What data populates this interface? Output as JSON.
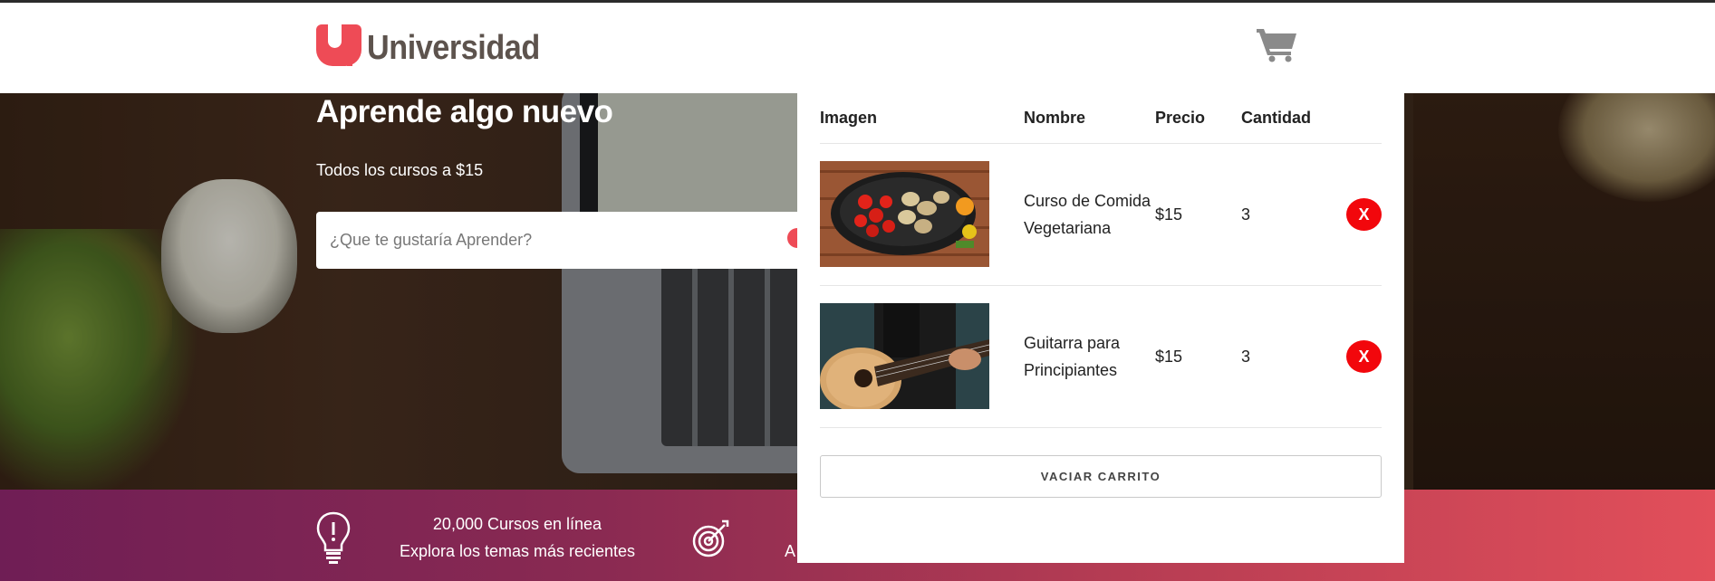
{
  "header": {
    "logo_text": "Universidad",
    "cart_icon": "shopping-cart-icon"
  },
  "hero": {
    "title": "Aprende algo nuevo",
    "subtitle": "Todos los cursos a $15",
    "search": {
      "placeholder": "¿Que te gustaría Aprender?",
      "value": ""
    }
  },
  "bar": {
    "item1": {
      "icon": "lightbulb-icon",
      "line1": "20,000 Cursos en línea",
      "line2": "Explora los temas más recientes"
    },
    "item2": {
      "icon": "target-icon",
      "text": "A"
    }
  },
  "cart": {
    "headers": {
      "image": "Imagen",
      "name": "Nombre",
      "price": "Precio",
      "quantity": "Cantidad"
    },
    "items": [
      {
        "image": "vegetable-pot-photo",
        "name": "Curso de Comida Vegetariana",
        "price": "$15",
        "quantity": "3",
        "delete_label": "X"
      },
      {
        "image": "guitar-player-photo",
        "name": "Guitarra para Principiantes",
        "price": "$15",
        "quantity": "3",
        "delete_label": "X"
      }
    ],
    "clear_label": "VACIAR CARRITO"
  },
  "colors": {
    "brand": "#ee4b56",
    "delete": "#f2070c",
    "bar_start": "#6f1e55",
    "bar_end": "#e24f5a"
  }
}
